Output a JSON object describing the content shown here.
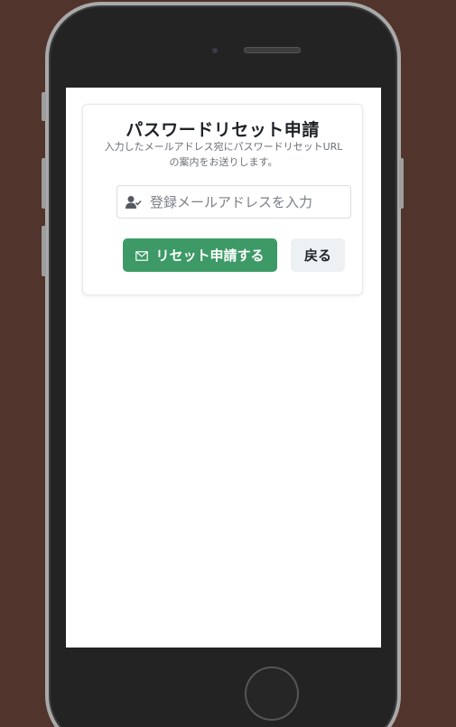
{
  "form": {
    "title": "パスワードリセット申請",
    "description_line1": "入力したメールアドレス宛にパスワードリセットURL",
    "description_line2": "の案内をお送りします。",
    "email_placeholder": "登録メールアドレスを入力",
    "email_value": "",
    "submit_label": "リセット申請する",
    "back_label": "戻る"
  },
  "icons": {
    "input": "user-check-icon",
    "submit": "mail-icon"
  },
  "colors": {
    "primary": "#3d9a66",
    "secondary_bg": "#eef1f4",
    "background": "#51342b"
  }
}
